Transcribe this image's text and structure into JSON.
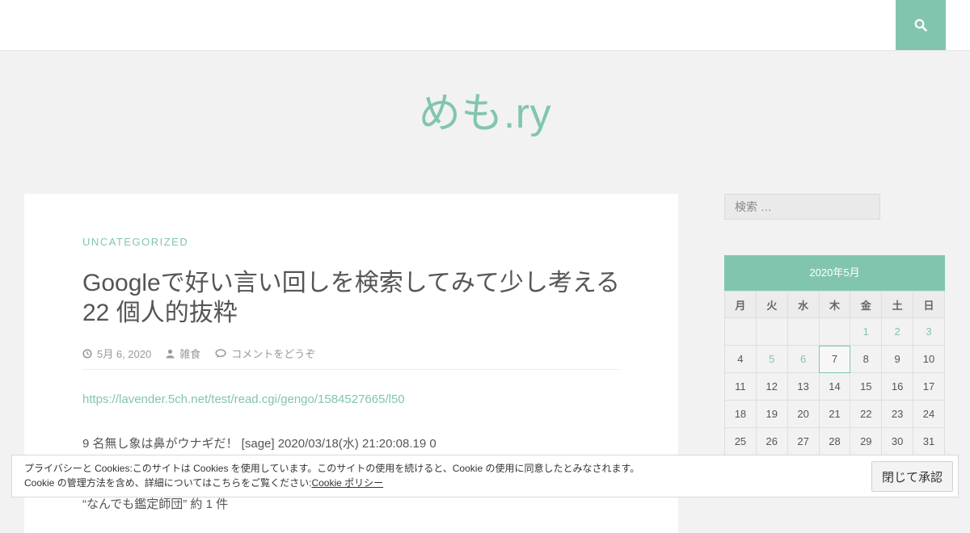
{
  "header": {
    "search_icon": "search-icon",
    "site_title": "めも.ry"
  },
  "post": {
    "category": "UNCATEGORIZED",
    "title": "Googleで好い言い回しを検索してみて少し考える 22 個人的抜粋",
    "meta": {
      "date": "5月 6, 2020",
      "author": "雑食",
      "comments": "コメントをどうぞ"
    },
    "link": "https://lavender.5ch.net/test/read.cgi/gengo/1584527665/l50",
    "lines": [
      "9 名無し象は鼻がウナギだ！ [sage] 2020/03/18(水) 21:20:08.19 0",
      "“なんでも鑑定師団” 約 1 件"
    ]
  },
  "sidebar": {
    "search_placeholder": "検索 …",
    "calendar": {
      "caption": "2020年5月",
      "weekdays": [
        "月",
        "火",
        "水",
        "木",
        "金",
        "土",
        "日"
      ],
      "weeks": [
        [
          "",
          "",
          "",
          "",
          "1",
          "2",
          "3"
        ],
        [
          "4",
          "5",
          "6",
          "7",
          "8",
          "9",
          "10"
        ],
        [
          "11",
          "12",
          "13",
          "14",
          "15",
          "16",
          "17"
        ],
        [
          "18",
          "19",
          "20",
          "21",
          "22",
          "23",
          "24"
        ],
        [
          "25",
          "26",
          "27",
          "28",
          "29",
          "30",
          "31"
        ]
      ],
      "linked_days": [
        "1",
        "2",
        "3",
        "5",
        "6"
      ],
      "today": "7"
    }
  },
  "cookie": {
    "line1": "プライバシーと Cookies:このサイトは Cookies を使用しています。このサイトの使用を続けると、Cookie の使用に同意したとみなされます。",
    "line2": "Cookie の管理方法を含め、詳細についてはこちらをご覧ください:",
    "policy_link": "Cookie ポリシー",
    "button": "閉じて承認"
  },
  "colors": {
    "accent": "#82c5af",
    "background": "#f2f2f2"
  }
}
